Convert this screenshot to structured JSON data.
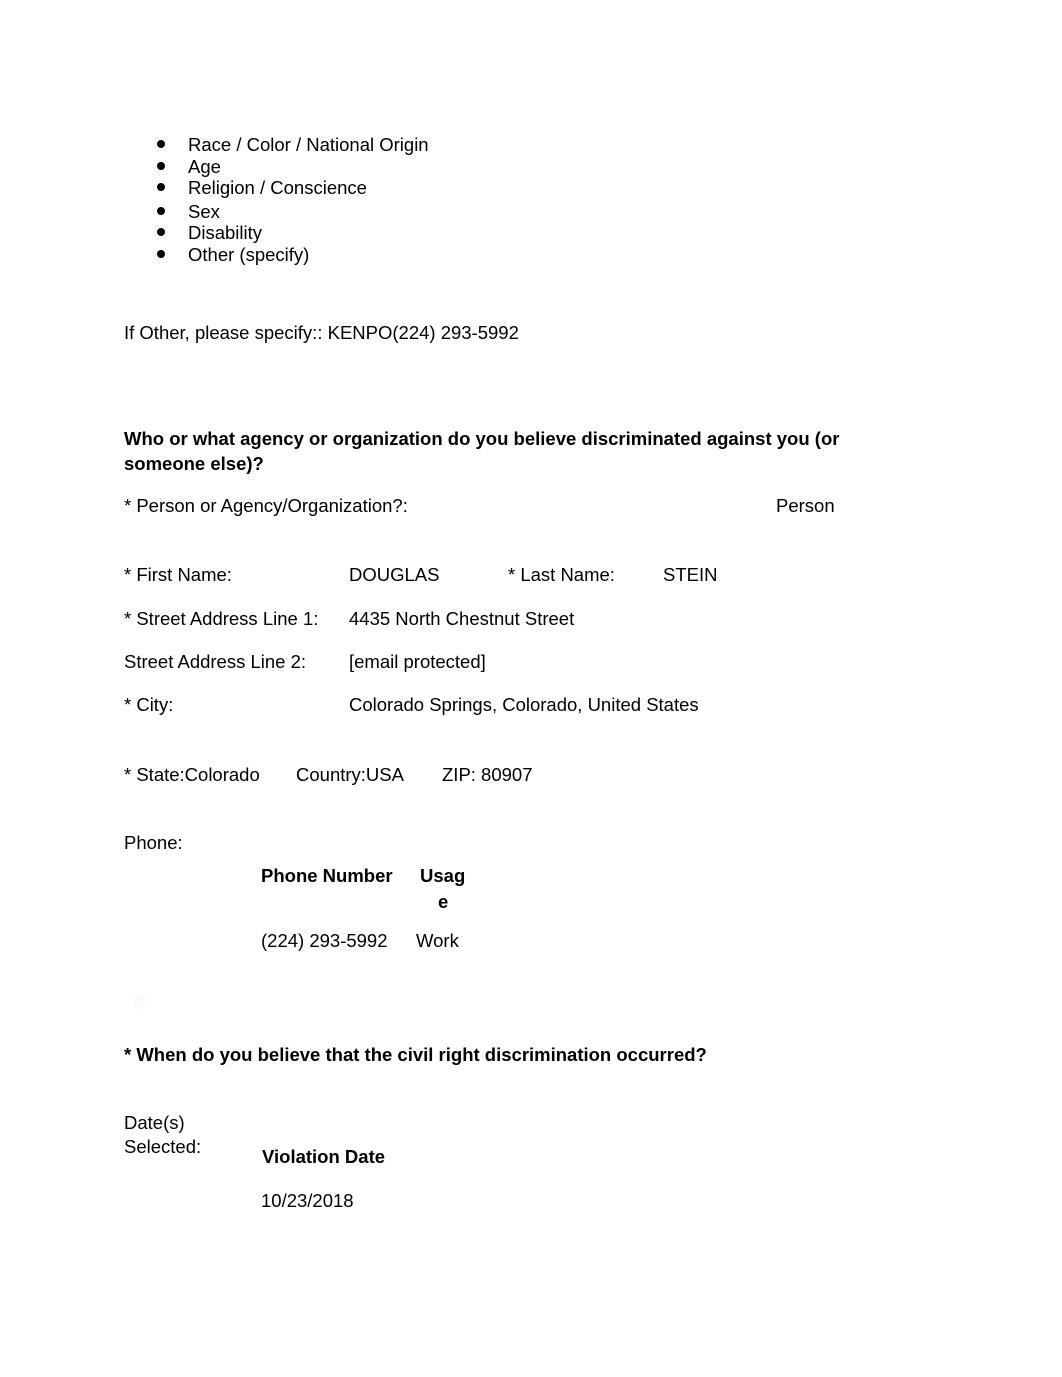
{
  "basis_list": {
    "items": [
      "Race / Color / National Origin",
      "Age",
      "Religion / Conscience",
      "Sex",
      "Disability",
      "Other (specify)"
    ]
  },
  "other_specify": {
    "text": "If Other, please specify:: KENPO(224) 293-5992"
  },
  "respondent_section": {
    "heading_line1": "Who or what agency or organization do you believe discriminated against you (or",
    "heading_line2": "someone else)?",
    "type_label": "* Person or Agency/Organization?:",
    "type_value": "Person",
    "first_name_label": "* First Name:",
    "first_name_value": "DOUGLAS",
    "last_name_label": "* Last Name:",
    "last_name_value": "STEIN",
    "address1_label": "* Street Address Line 1:",
    "address1_value": "4435 North Chestnut Street",
    "address2_label": "Street Address Line 2:",
    "address2_value": "[email protected]",
    "city_label": "* City:",
    "city_value": "Colorado Springs, Colorado, United States",
    "state_text": "* State:Colorado",
    "country_text": "Country:USA",
    "zip_text": "ZIP: 80907",
    "phone_label": "Phone:",
    "phone_table": {
      "headers": [
        "Phone Number",
        "Usag",
        "e"
      ],
      "rows": [
        {
          "number": "(224) 293-5992",
          "usage": "Work"
        }
      ]
    }
  },
  "date_section": {
    "heading": "* When do you believe that the civil right discrimination occurred?",
    "dates_label_line1": "Date(s)",
    "dates_label_line2": "Selected:",
    "table_header": "Violation Date",
    "dates": [
      "10/23/2018"
    ]
  }
}
